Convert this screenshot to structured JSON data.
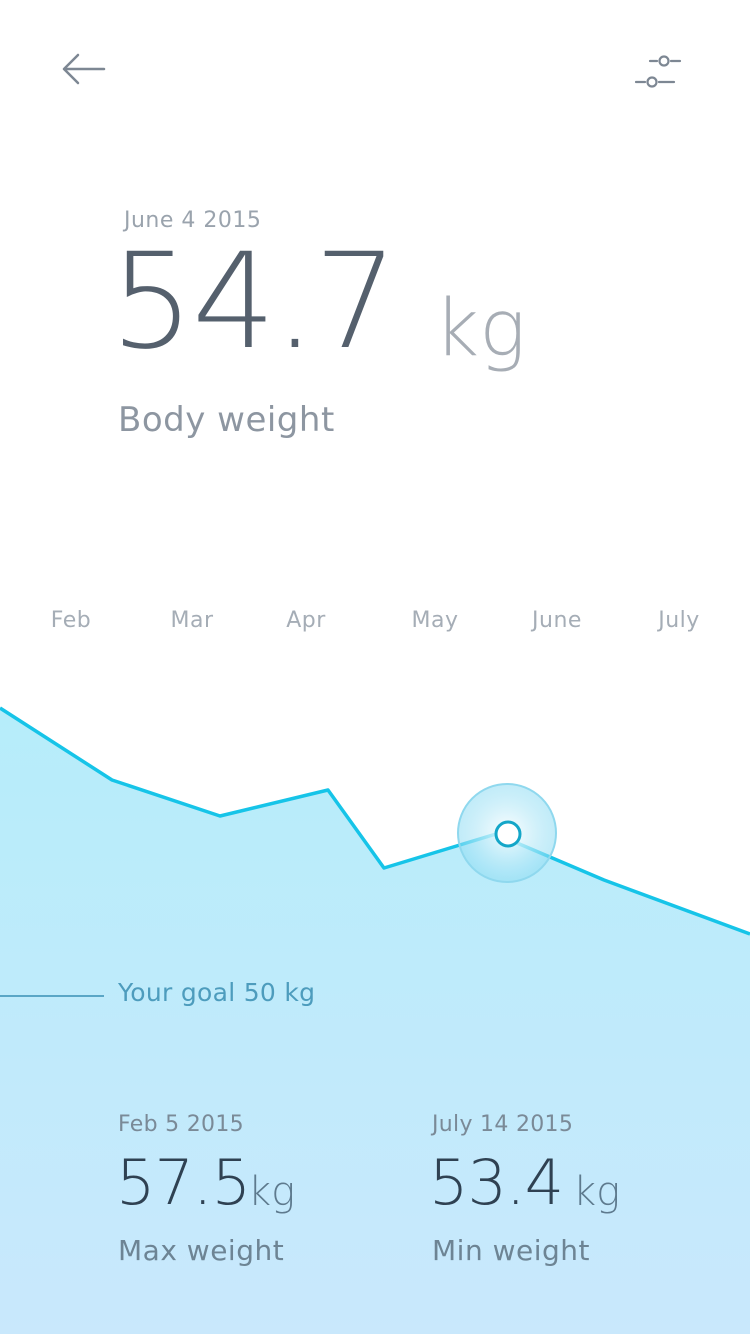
{
  "header": {
    "back_icon": "arrow-left-icon",
    "filter_icon": "sliders-icon"
  },
  "current": {
    "date": "June 4 2015",
    "value": "54.7",
    "unit": "kg",
    "label": "Body weight"
  },
  "months": [
    "Feb",
    "Mar",
    "Apr",
    "May",
    "June",
    "July"
  ],
  "goal": {
    "text": "Your goal 50 kg"
  },
  "stats": {
    "max": {
      "date": "Feb 5 2015",
      "value": "57.5",
      "unit": "kg",
      "label": "Max weight"
    },
    "min": {
      "date": "July 14 2015",
      "value": "53.4",
      "unit": "kg",
      "label": "Min weight"
    }
  },
  "colors": {
    "line": "#16c4e8",
    "fill_top": "#b8ecfa",
    "fill_bottom": "#c7e9fc",
    "text_primary": "#55606d"
  }
}
